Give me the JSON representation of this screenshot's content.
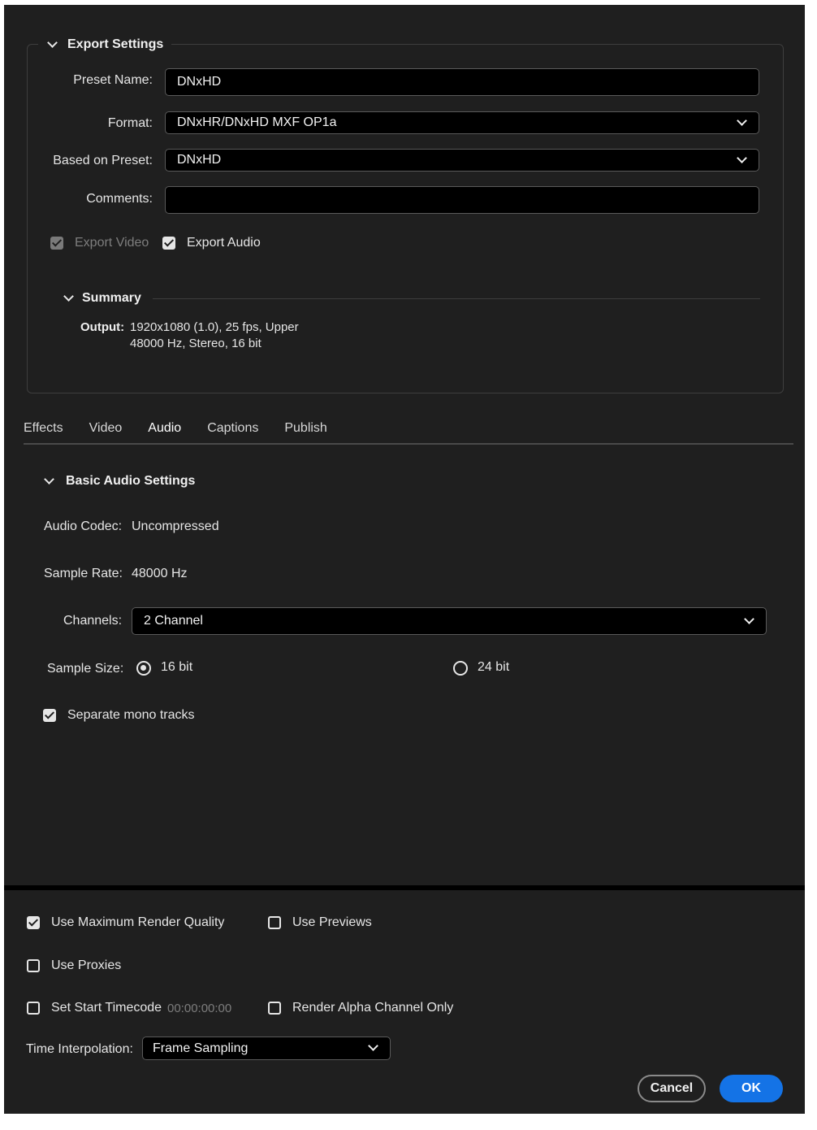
{
  "export_settings": {
    "title": "Export Settings",
    "preset_name_label": "Preset Name:",
    "preset_name_value": "DNxHD",
    "format_label": "Format:",
    "format_value": "DNxHR/DNxHD MXF OP1a",
    "based_on_label": "Based on Preset:",
    "based_on_value": "DNxHD",
    "comments_label": "Comments:",
    "comments_value": "",
    "export_video_label": "Export Video",
    "export_video_checked": true,
    "export_audio_label": "Export Audio",
    "export_audio_checked": true,
    "summary": {
      "title": "Summary",
      "output_label": "Output:",
      "output_line1": "1920x1080 (1.0), 25 fps, Upper",
      "output_line2": "48000 Hz, Stereo, 16 bit"
    }
  },
  "tabs": [
    {
      "label": "Effects",
      "active": false
    },
    {
      "label": "Video",
      "active": false
    },
    {
      "label": "Audio",
      "active": true
    },
    {
      "label": "Captions",
      "active": false
    },
    {
      "label": "Publish",
      "active": false
    }
  ],
  "audio": {
    "section_title": "Basic Audio Settings",
    "codec_label": "Audio Codec:",
    "codec_value": "Uncompressed",
    "sample_rate_label": "Sample Rate:",
    "sample_rate_value": "48000 Hz",
    "channels_label": "Channels:",
    "channels_value": "2 Channel",
    "sample_size_label": "Sample Size:",
    "sample_size_options": [
      {
        "label": "16 bit",
        "selected": true
      },
      {
        "label": "24 bit",
        "selected": false
      }
    ],
    "separate_mono_label": "Separate mono tracks",
    "separate_mono_checked": true
  },
  "render": {
    "max_quality_label": "Use Maximum Render Quality",
    "max_quality_checked": true,
    "use_previews_label": "Use Previews",
    "use_previews_checked": false,
    "use_proxies_label": "Use Proxies",
    "use_proxies_checked": false,
    "start_timecode_label": "Set Start Timecode",
    "start_timecode_value": "00:00:00:00",
    "start_timecode_checked": false,
    "alpha_only_label": "Render Alpha Channel Only",
    "alpha_only_checked": false,
    "time_interp_label": "Time Interpolation:",
    "time_interp_value": "Frame Sampling"
  },
  "buttons": {
    "cancel": "Cancel",
    "ok": "OK"
  },
  "colors": {
    "background": "#1f1f1f",
    "accent": "#1473e6",
    "field": "#000000"
  }
}
